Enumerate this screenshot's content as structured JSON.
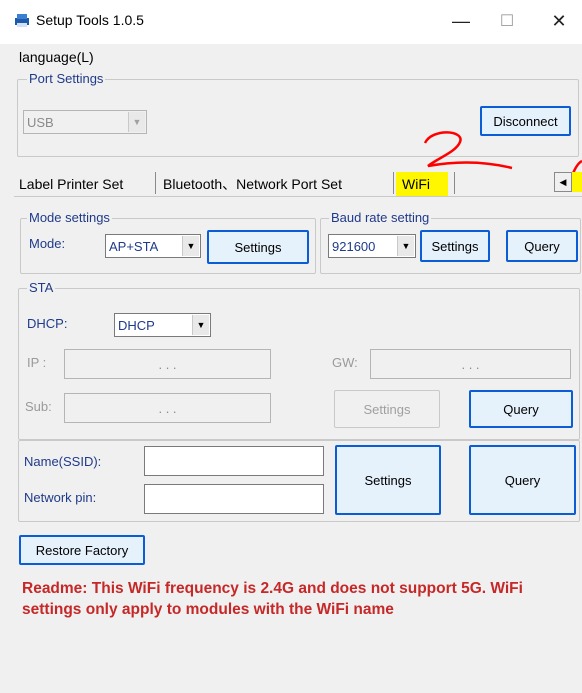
{
  "window": {
    "title": "Setup Tools 1.0.5",
    "minimize_glyph": "—",
    "maximize_glyph": "☐",
    "close_glyph": "✕"
  },
  "menu": {
    "language": "language(L)"
  },
  "port_settings": {
    "legend": "Port Settings",
    "port_value": "USB",
    "disconnect_label": "Disconnect"
  },
  "tabs": {
    "items": [
      "Label Printer Set",
      "Bluetooth、Network Port Set",
      "WiFi"
    ],
    "active": "WiFi",
    "scroll_left_glyph": "◀"
  },
  "mode_settings": {
    "legend": "Mode settings",
    "mode_label": "Mode:",
    "mode_value": "AP+STA",
    "settings_label": "Settings"
  },
  "baud_rate": {
    "legend": "Baud rate setting",
    "value": "921600",
    "settings_label": "Settings",
    "query_label": "Query"
  },
  "sta": {
    "legend": "STA",
    "dhcp_label": "DHCP:",
    "dhcp_value": "DHCP",
    "ip_label": "IP :",
    "gw_label": "GW:",
    "sub_label": "Sub:",
    "ip_dots": ". . .",
    "settings_label": "Settings",
    "query_label": "Query"
  },
  "wifi": {
    "ssid_label": "Name(SSID):",
    "ssid_value": "",
    "pin_label": "Network pin:",
    "pin_value": "",
    "settings_label": "Settings",
    "query_label": "Query"
  },
  "restore_label": "Restore Factory",
  "readme": "Readme: This WiFi frequency is 2.4G and does not support 5G. WiFi settings only apply to modules with the WiFi name",
  "colors": {
    "highlight": "#fff700",
    "annotation": "#ff0000",
    "readme": "#c62828"
  },
  "annotation_text": "2"
}
